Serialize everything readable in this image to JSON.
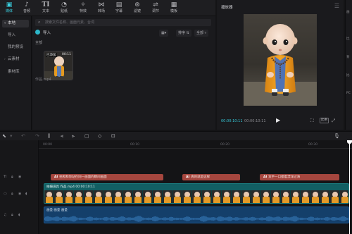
{
  "toolbar": {
    "tools": [
      {
        "label": "媒体",
        "icon": "media-icon"
      },
      {
        "label": "音频",
        "icon": "audio-icon"
      },
      {
        "label": "文本",
        "icon": "text-icon"
      },
      {
        "label": "贴纸",
        "icon": "sticker-icon"
      },
      {
        "label": "特效",
        "icon": "effects-icon"
      },
      {
        "label": "转场",
        "icon": "transition-icon"
      },
      {
        "label": "字幕",
        "icon": "captions-icon"
      },
      {
        "label": "滤镜",
        "icon": "filter-icon"
      },
      {
        "label": "调节",
        "icon": "adjust-icon"
      },
      {
        "label": "模板",
        "icon": "template-icon"
      }
    ],
    "active_index": 0
  },
  "left_nav": {
    "items": [
      {
        "label": "本地",
        "caret": "▾",
        "selected": true
      },
      {
        "label": "导入",
        "caret": "",
        "selected": false
      },
      {
        "label": "我的预设",
        "caret": "",
        "selected": false
      },
      {
        "label": "云素材",
        "caret": "›",
        "selected": false
      },
      {
        "label": "素材库",
        "caret": "",
        "selected": false
      }
    ]
  },
  "media_panel": {
    "search_placeholder": "搜索文件名称、画面元素、台词",
    "import_label": "导入",
    "view_label": "▦▾",
    "sort_label": "排序 ⇅",
    "filter_label": "全部 ▿",
    "all_label": "全部",
    "thumb": {
      "added_badge": "已添加",
      "duration": "00:11",
      "name": "作品.mp4"
    }
  },
  "player": {
    "title": "播放器",
    "menu_icon": "☰",
    "timecode_current": "00:00:10:11",
    "timecode_total": "00:00:10:11",
    "ratio_label": "比例"
  },
  "right_panel": {
    "tabs": [
      "画",
      "比",
      "背",
      "比",
      "PC"
    ]
  },
  "timeline": {
    "ruler_labels": [
      "00:00",
      "00:05",
      "00:10",
      "00:15",
      "00:20",
      "00:25",
      "00:30",
      "00:35",
      "00:40",
      "00:45",
      "00:50"
    ],
    "text_clips": [
      {
        "tag": "AI",
        "text": "拍照和你站在同一画面的瞬间画面"
      },
      {
        "tag": "AI",
        "text": "真的就是这样"
      },
      {
        "tag": "AI",
        "text": "双手一口都着漂洋过海"
      }
    ],
    "video_clip": {
      "label": "拍摄道具 作品.mp4  00:00:10:11",
      "frame_count": 31
    },
    "audio_clip": {
      "label": "画圣 画圣 画圣"
    }
  },
  "colors": {
    "accent": "#2cb7c9",
    "text_clip": "#a5463e",
    "video_clip": "#125f63",
    "audio_clip": "#143f6a"
  }
}
